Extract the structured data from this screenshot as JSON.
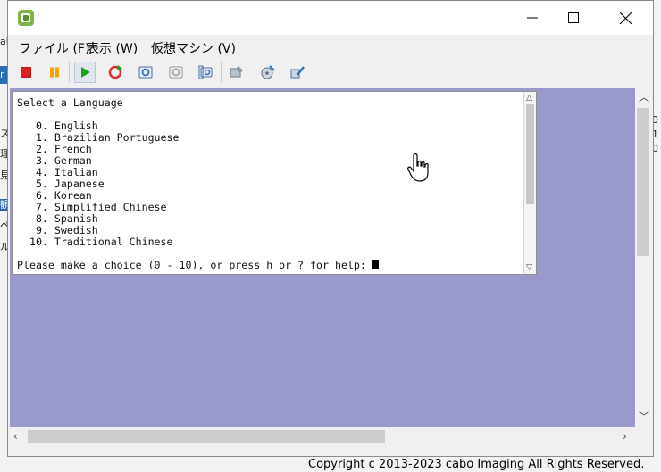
{
  "window": {
    "title": ""
  },
  "menu": {
    "items": [
      "ファイル (F)",
      "表示 (W)",
      "仮想マシン (V)"
    ]
  },
  "toolbar": {
    "buttons": [
      {
        "name": "stop-icon",
        "color": "#e21b1b"
      },
      {
        "name": "pause-icon",
        "color": "#f2a400"
      },
      {
        "name": "play-icon",
        "color": "#1aa31a"
      },
      {
        "name": "reset-icon",
        "color": "#d63030"
      },
      {
        "name": "snapshot-icon"
      },
      {
        "name": "snapshot-revert-icon"
      },
      {
        "name": "snapshot-manager-icon"
      },
      {
        "name": "settings-icon"
      },
      {
        "name": "media-icon"
      },
      {
        "name": "tools-icon"
      }
    ]
  },
  "console": {
    "lines": [
      "Select a Language",
      "",
      "   0. English",
      "   1. Brazilian Portuguese",
      "   2. French",
      "   3. German",
      "   4. Italian",
      "   5. Japanese",
      "   6. Korean",
      "   7. Simplified Chinese",
      "   8. Spanish",
      "   9. Swedish",
      "  10. Traditional Chinese",
      ""
    ],
    "prompt": "Please make a choice (0 - 10), or press h or ? for help: "
  },
  "background": {
    "left_fragments": [
      "ab",
      "r",
      "ス",
      "理",
      "見",
      "観",
      "ペ",
      "ル"
    ],
    "right_fragments": [
      "0",
      "1",
      "0"
    ]
  },
  "footer": {
    "copyright": "Copyright c 2013-2023 cabo Imaging All Rights Reserved."
  },
  "colors": {
    "client_bg": "#9999cc",
    "accent": "#1aa31a"
  }
}
